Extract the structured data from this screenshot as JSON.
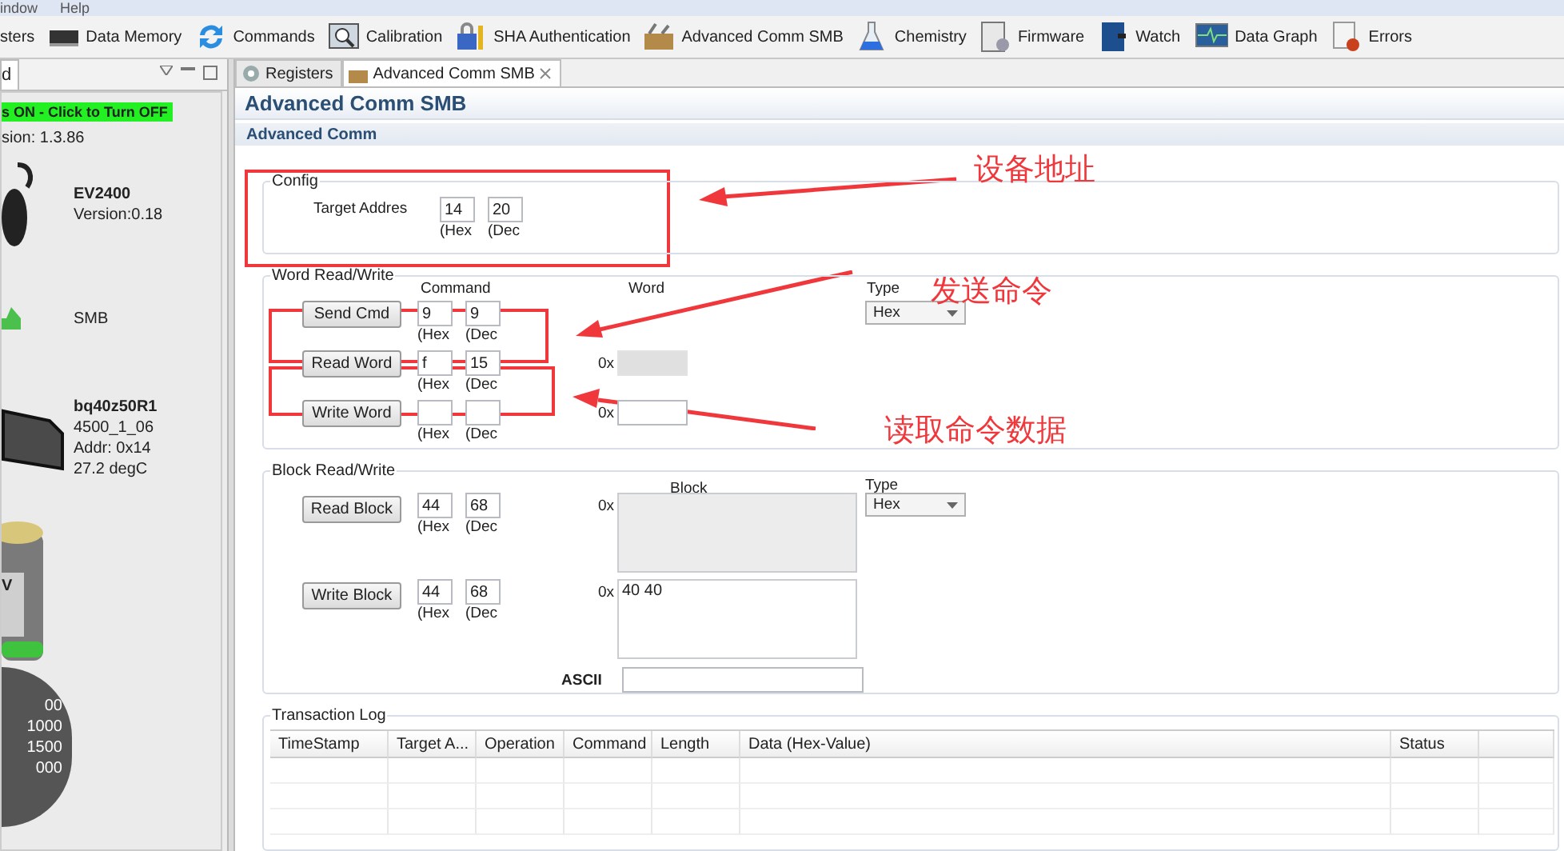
{
  "menu": [
    "indow",
    "Help"
  ],
  "toolbar": [
    "sters",
    "Data Memory",
    "Commands",
    "Calibration",
    "SHA Authentication",
    "Advanced Comm SMB",
    "Chemistry",
    "Firmware",
    "Watch",
    "Data Graph",
    "Errors"
  ],
  "left_panel": {
    "tab": "d",
    "status_button": "s ON - Click to Turn OFF",
    "version": "sion:  1.3.86",
    "adapter": {
      "name": "EV2400",
      "version": "Version:0.18"
    },
    "bus": "SMB",
    "device": {
      "name": "bq40z50R1",
      "lines": [
        "4500_1_06",
        "Addr: 0x14",
        "27.2 degC"
      ]
    },
    "battery_label": "V",
    "gauge_labels": [
      "00",
      "1000",
      "1500",
      "000"
    ]
  },
  "editor_tabs": [
    {
      "label": "Registers",
      "selected": false
    },
    {
      "label": "Advanced Comm SMB",
      "selected": true,
      "closable": true
    }
  ],
  "title": "Advanced Comm SMB",
  "section": "Advanced Comm",
  "config": {
    "title": "Config",
    "label": "Target Addres",
    "hex": "14",
    "dec": "20",
    "hex_label": "(Hex",
    "dec_label": "(Dec"
  },
  "word_rw": {
    "title": "Word Read/Write",
    "command_header": "Command",
    "word_header": "Word",
    "type_label": "Type",
    "type_value": "Hex",
    "rows": [
      {
        "button": "Send Cmd",
        "hex": "9",
        "dec": "9",
        "hex_label": "(Hex",
        "dec_label": "(Dec"
      },
      {
        "button": "Read Word",
        "hex": "f",
        "dec": "15",
        "hex_label": "(Hex",
        "dec_label": "(Dec",
        "prefix": "0x",
        "word_field": {
          "disabled": true
        }
      },
      {
        "button": "Write Word",
        "hex_label": "(Hex",
        "dec_label": "(Dec",
        "prefix": "0x",
        "word_field": {
          "disabled": false
        }
      }
    ]
  },
  "block_rw": {
    "title": "Block Read/Write",
    "block_header": "Block",
    "type_label": "Type",
    "type_value": "Hex",
    "ascii_label": "ASCII",
    "rows": [
      {
        "button": "Read Block",
        "hex": "44",
        "dec": "68",
        "hex_label": "(Hex",
        "dec_label": "(Dec",
        "prefix": "0x",
        "block_field": {
          "disabled": true
        }
      },
      {
        "button": "Write Block",
        "hex": "44",
        "dec": "68",
        "hex_label": "(Hex",
        "dec_label": "(Dec",
        "prefix": "0x",
        "block_field": {
          "disabled": false,
          "value": "40 40"
        }
      }
    ]
  },
  "transaction_log": {
    "title": "Transaction Log",
    "columns": [
      "TimeStamp",
      "Target A...",
      "Operation",
      "Command",
      "Length",
      "Data (Hex-Value)",
      "Status",
      ""
    ]
  },
  "annotations": [
    {
      "text": "设备地址"
    },
    {
      "text": "发送命令"
    },
    {
      "text": "读取命令数据"
    }
  ]
}
